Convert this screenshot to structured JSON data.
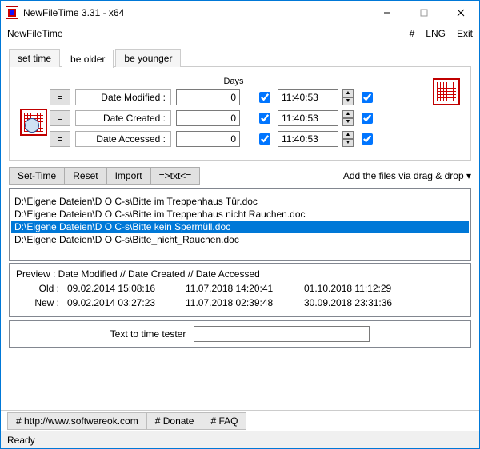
{
  "window": {
    "title": "NewFileTime 3.31 - x64"
  },
  "menubar": {
    "app": "NewFileTime",
    "hash": "#",
    "lng": "LNG",
    "exit": "Exit"
  },
  "tabs": {
    "set_time": "set time",
    "be_older": "be older",
    "be_younger": "be younger"
  },
  "panel": {
    "days_header": "Days",
    "eq": "=",
    "rows": [
      {
        "label": "Date Modified :",
        "days": "0",
        "time": "11:40:53"
      },
      {
        "label": "Date Created :",
        "days": "0",
        "time": "11:40:53"
      },
      {
        "label": "Date Accessed :",
        "days": "0",
        "time": "11:40:53"
      }
    ]
  },
  "toolbar": {
    "set_time": "Set-Time",
    "reset": "Reset",
    "import": "Import",
    "txt": "=>txt<=",
    "dragdrop": "Add the files via drag & drop  ▾"
  },
  "files": [
    "D:\\Eigene Dateien\\D O C-s\\Bitte im Treppenhaus Tür.doc",
    "D:\\Eigene Dateien\\D O C-s\\Bitte im Treppenhaus nicht Rauchen.doc",
    "D:\\Eigene Dateien\\D O C-s\\Bitte kein Spermüll.doc",
    "D:\\Eigene Dateien\\D O C-s\\Bitte_nicht_Rauchen.doc"
  ],
  "preview": {
    "header": "Preview :   Date Modified    //   Date Created    //   Date Accessed",
    "old_label": "Old :",
    "new_label": "New :",
    "old": {
      "modified": "09.02.2014 15:08:16",
      "created": "11.07.2018 14:20:41",
      "accessed": "01.10.2018 11:12:29"
    },
    "new": {
      "modified": "09.02.2014 03:27:23",
      "created": "11.07.2018 02:39:48",
      "accessed": "30.09.2018 23:31:36"
    }
  },
  "tester": {
    "label": "Text to time tester",
    "value": ""
  },
  "bottombar": {
    "site": "# http://www.softwareok.com",
    "donate": "# Donate",
    "faq": "# FAQ"
  },
  "status": "Ready"
}
